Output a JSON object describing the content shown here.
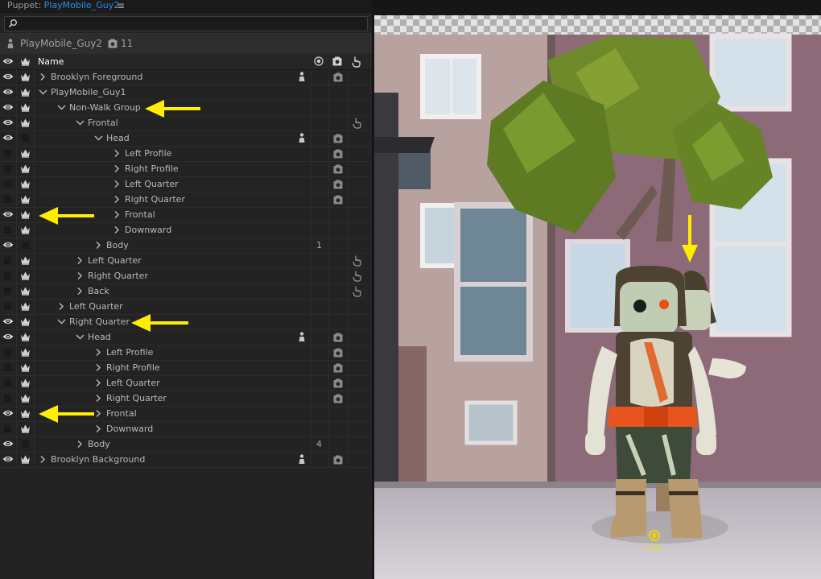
{
  "panel": {
    "tab_prefix": "Puppet: ",
    "tab_name": "PlayMobile_Guy2",
    "menu_glyph": "≡",
    "search_placeholder": "",
    "puppet_name": "PlayMobile_Guy2",
    "puppet_count": "11",
    "column_name": "Name"
  },
  "rows": [
    {
      "label": "Brooklyn Foreground",
      "depth": 0,
      "expanded": false,
      "eye": true,
      "crown": true,
      "person": true,
      "camera": true,
      "hand": false,
      "num": ""
    },
    {
      "label": "PlayMobile_Guy1",
      "depth": 0,
      "expanded": true,
      "eye": true,
      "crown": true,
      "person": false,
      "camera": false,
      "hand": false,
      "num": ""
    },
    {
      "label": "Non-Walk Group",
      "depth": 1,
      "expanded": true,
      "eye": true,
      "crown": true,
      "person": false,
      "camera": false,
      "hand": false,
      "num": ""
    },
    {
      "label": "Frontal",
      "depth": 2,
      "expanded": true,
      "eye": true,
      "crown": true,
      "person": false,
      "camera": false,
      "hand": true,
      "num": ""
    },
    {
      "label": "Head",
      "depth": 3,
      "expanded": true,
      "eye": true,
      "crown": false,
      "person": true,
      "camera": true,
      "hand": false,
      "num": ""
    },
    {
      "label": "Left Profile",
      "depth": 4,
      "expanded": false,
      "eye": false,
      "crown": true,
      "person": false,
      "camera": true,
      "hand": false,
      "num": ""
    },
    {
      "label": "Right Profile",
      "depth": 4,
      "expanded": false,
      "eye": false,
      "crown": true,
      "person": false,
      "camera": true,
      "hand": false,
      "num": ""
    },
    {
      "label": "Left Quarter",
      "depth": 4,
      "expanded": false,
      "eye": false,
      "crown": true,
      "person": false,
      "camera": true,
      "hand": false,
      "num": ""
    },
    {
      "label": "Right Quarter",
      "depth": 4,
      "expanded": false,
      "eye": false,
      "crown": true,
      "person": false,
      "camera": true,
      "hand": false,
      "num": ""
    },
    {
      "label": "Frontal",
      "depth": 4,
      "expanded": false,
      "eye": true,
      "crown": true,
      "person": false,
      "camera": false,
      "hand": false,
      "num": ""
    },
    {
      "label": "Downward",
      "depth": 4,
      "expanded": false,
      "eye": false,
      "crown": true,
      "person": false,
      "camera": false,
      "hand": false,
      "num": ""
    },
    {
      "label": "Body",
      "depth": 3,
      "expanded": false,
      "eye": true,
      "crown": false,
      "person": false,
      "camera": false,
      "hand": false,
      "num": "1"
    },
    {
      "label": "Left Quarter",
      "depth": 2,
      "expanded": false,
      "eye": false,
      "crown": true,
      "person": false,
      "camera": false,
      "hand": true,
      "num": ""
    },
    {
      "label": "Right Quarter",
      "depth": 2,
      "expanded": false,
      "eye": false,
      "crown": true,
      "person": false,
      "camera": false,
      "hand": true,
      "num": ""
    },
    {
      "label": "Back",
      "depth": 2,
      "expanded": false,
      "eye": false,
      "crown": true,
      "person": false,
      "camera": false,
      "hand": true,
      "num": ""
    },
    {
      "label": "Left Quarter",
      "depth": 1,
      "expanded": false,
      "eye": false,
      "crown": true,
      "person": false,
      "camera": false,
      "hand": false,
      "num": ""
    },
    {
      "label": "Right Quarter",
      "depth": 1,
      "expanded": true,
      "eye": true,
      "crown": true,
      "person": false,
      "camera": false,
      "hand": false,
      "num": ""
    },
    {
      "label": "Head",
      "depth": 2,
      "expanded": true,
      "eye": true,
      "crown": true,
      "person": true,
      "camera": true,
      "hand": false,
      "num": ""
    },
    {
      "label": "Left Profile",
      "depth": 3,
      "expanded": false,
      "eye": false,
      "crown": true,
      "person": false,
      "camera": true,
      "hand": false,
      "num": ""
    },
    {
      "label": "Right Profile",
      "depth": 3,
      "expanded": false,
      "eye": false,
      "crown": true,
      "person": false,
      "camera": true,
      "hand": false,
      "num": ""
    },
    {
      "label": "Left Quarter",
      "depth": 3,
      "expanded": false,
      "eye": false,
      "crown": true,
      "person": false,
      "camera": true,
      "hand": false,
      "num": ""
    },
    {
      "label": "Right Quarter",
      "depth": 3,
      "expanded": false,
      "eye": false,
      "crown": true,
      "person": false,
      "camera": true,
      "hand": false,
      "num": ""
    },
    {
      "label": "Frontal",
      "depth": 3,
      "expanded": false,
      "eye": true,
      "crown": true,
      "person": false,
      "camera": false,
      "hand": false,
      "num": ""
    },
    {
      "label": "Downward",
      "depth": 3,
      "expanded": false,
      "eye": false,
      "crown": true,
      "person": false,
      "camera": false,
      "hand": false,
      "num": ""
    },
    {
      "label": "Body",
      "depth": 2,
      "expanded": false,
      "eye": true,
      "crown": false,
      "person": false,
      "camera": false,
      "hand": false,
      "num": "4"
    },
    {
      "label": "Brooklyn Background",
      "depth": 0,
      "expanded": false,
      "eye": true,
      "crown": true,
      "person": true,
      "camera": true,
      "hand": false,
      "num": ""
    }
  ],
  "scene": {
    "origin_label": "origin"
  },
  "colors": {
    "accent_blue": "#2d8ceb",
    "annotation_yellow": "#ffee00"
  }
}
